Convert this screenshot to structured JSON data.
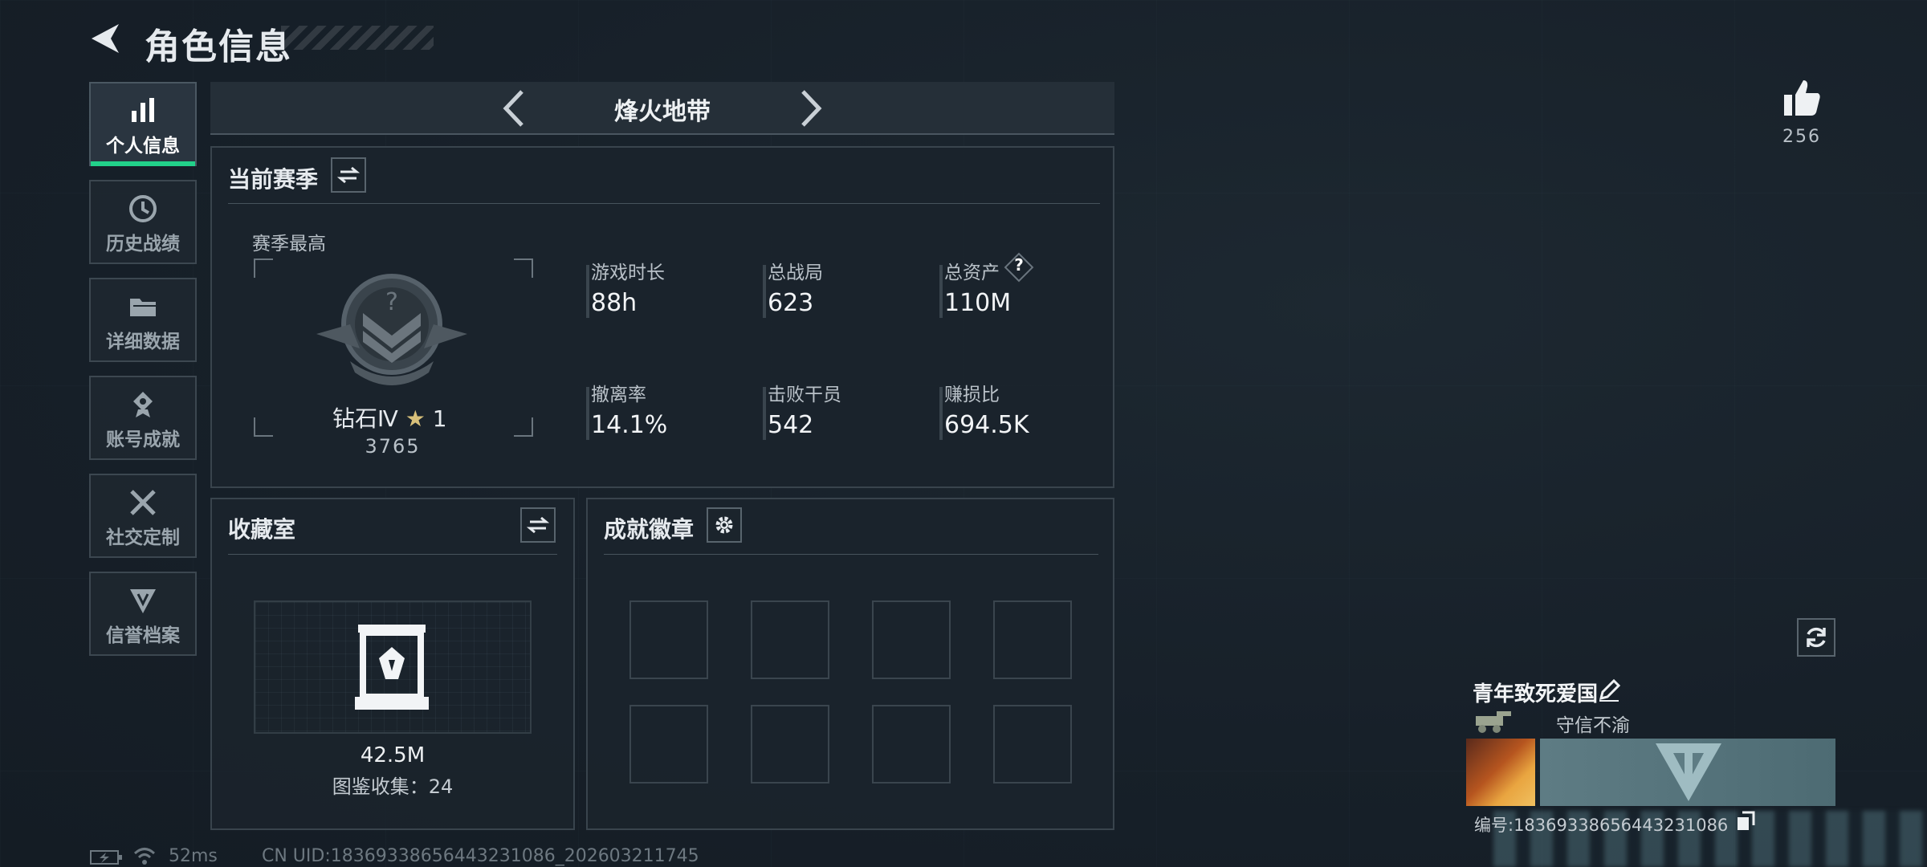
{
  "header": {
    "title": "角色信息"
  },
  "sidebar": {
    "items": [
      {
        "label": "个人信息",
        "icon": "bar-chart-icon",
        "active": true
      },
      {
        "label": "历史战绩",
        "icon": "history-icon"
      },
      {
        "label": "详细数据",
        "icon": "folder-icon"
      },
      {
        "label": "账号成就",
        "icon": "achievement-icon"
      },
      {
        "label": "社交定制",
        "icon": "tools-icon"
      },
      {
        "label": "信誉档案",
        "icon": "credit-icon"
      }
    ]
  },
  "mode_selector": {
    "label": "烽火地带"
  },
  "season": {
    "title": "当前赛季",
    "best_label": "赛季最高",
    "rank_name": "钻石Ⅳ",
    "rank_stars": "1",
    "rank_score": "3765",
    "stats": [
      {
        "label": "游戏时长",
        "value": "88h"
      },
      {
        "label": "总战局",
        "value": "623"
      },
      {
        "label": "总资产",
        "value": "110M",
        "help": "?"
      },
      {
        "label": "撤离率",
        "value": "14.1%"
      },
      {
        "label": "击败干员",
        "value": "542"
      },
      {
        "label": "赚损比",
        "value": "694.5K"
      }
    ]
  },
  "collection": {
    "title": "收藏室",
    "value": "42.5M",
    "count_label": "图鉴收集：24"
  },
  "badges": {
    "title": "成就徽章",
    "slot_count": 8
  },
  "likes": {
    "count": "256"
  },
  "player": {
    "name": "青年致死爱国",
    "motto": "守信不渝",
    "id_label": "编号:18369338656443231086"
  },
  "footer": {
    "ping": "52ms",
    "uid": "CN UID:18369338656443231086_202603211745"
  },
  "colors": {
    "accent": "#22d18a",
    "panel_border": "#39444d",
    "background": "#172029"
  }
}
